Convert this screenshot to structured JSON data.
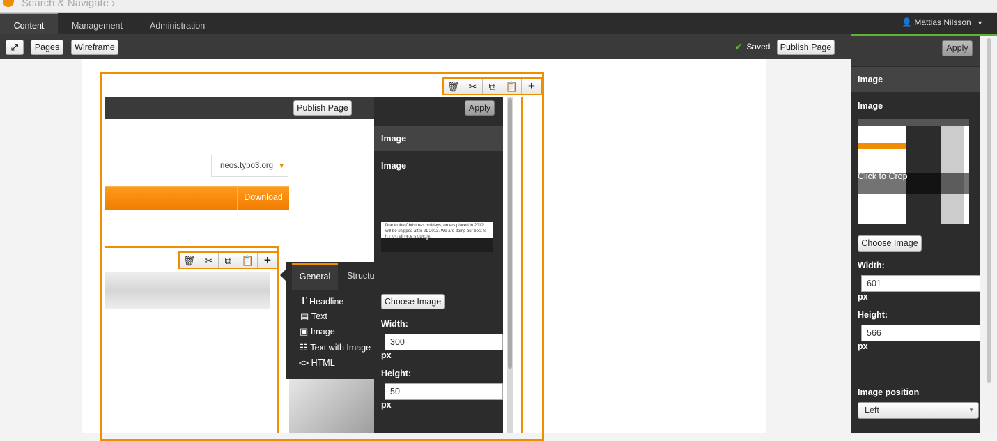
{
  "search": {
    "placeholder": "Search & Navigate ›"
  },
  "nav": {
    "tabs": [
      "Content",
      "Management",
      "Administration"
    ],
    "user": "Mattias Nilsson"
  },
  "toolbar": {
    "pages_label": "Pages",
    "wireframe_label": "Wireframe",
    "saved_label": "Saved",
    "publish_label": "Publish Page"
  },
  "inspector": {
    "apply_label": "Apply",
    "section_title": "Image",
    "field_label": "Image",
    "crop_label": "Click to Crop",
    "choose_label": "Choose Image",
    "width_label": "Width:",
    "width_value": "601",
    "height_label": "Height:",
    "height_value": "566",
    "unit": "px",
    "position_label": "Image position",
    "position_value": "Left"
  },
  "preview": {
    "publish_label": "Publish Page",
    "apply_label": "Apply",
    "section_title": "Image",
    "field_label": "Image",
    "crop_label": "Click to Crop",
    "thumb_text": "Due to the Christmas holidays, orders placed in 2012 will be shipped after 21 2013. We are doing our best to handle all orders quickly.",
    "choose_label": "Choose Image",
    "width_label": "Width:",
    "width_value": "300",
    "height_label": "Height:",
    "height_value": "50",
    "unit": "px",
    "site_select": "neos.typo3.org",
    "download_label": "Download",
    "menu": {
      "tabs": [
        "General",
        "Structu"
      ],
      "items": [
        "Headline",
        "Text",
        "Image",
        "Text with Image",
        "HTML"
      ]
    }
  },
  "colors": {
    "accent": "#f18d00",
    "dark": "#2c2c2c",
    "saved_check": "#5fb236"
  },
  "icons": [
    "neos-logo",
    "fullscreen-icon",
    "user-icon",
    "check-icon",
    "trash-icon",
    "scissors-icon",
    "copy-icon",
    "paste-icon",
    "plus-icon",
    "chevron-down-icon"
  ]
}
